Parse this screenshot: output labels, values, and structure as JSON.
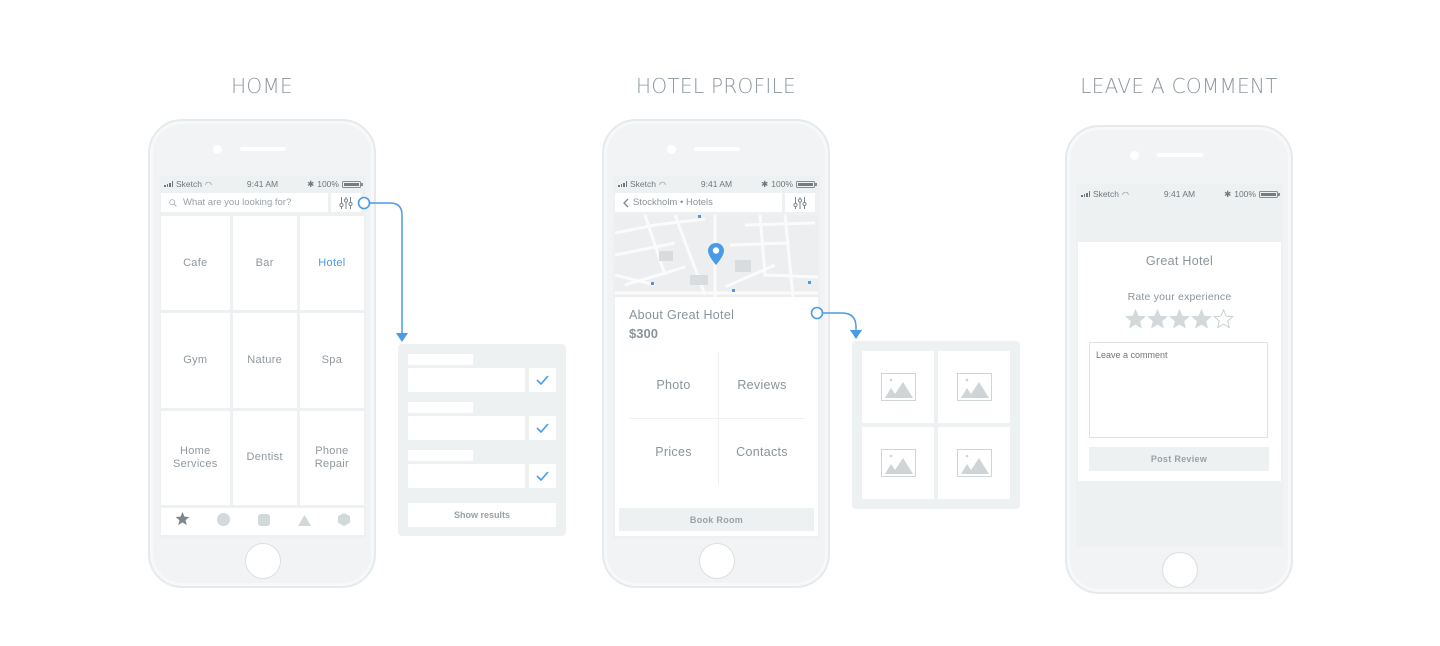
{
  "titles": {
    "home": "HOME",
    "hotel_profile": "HOTEL PROFILE",
    "leave_comment": "LEAVE A COMMENT"
  },
  "statusbar": {
    "carrier": "Sketch",
    "time": "9:41 AM",
    "battery": "100%"
  },
  "home": {
    "search_placeholder": "What are you looking for?",
    "categories": [
      {
        "label": "Cafe",
        "active": false
      },
      {
        "label": "Bar",
        "active": false
      },
      {
        "label": "Hotel",
        "active": true
      },
      {
        "label": "Gym",
        "active": false
      },
      {
        "label": "Nature",
        "active": false
      },
      {
        "label": "Spa",
        "active": false
      },
      {
        "label": "Home Services",
        "active": false
      },
      {
        "label": "Dentist",
        "active": false
      },
      {
        "label": "Phone Repair",
        "active": false
      }
    ],
    "tabbar": [
      "star-icon",
      "circle-icon",
      "square-icon",
      "triangle-icon",
      "hexagon-icon"
    ]
  },
  "filter_panel": {
    "rows_checked": [
      true,
      true,
      true
    ],
    "show_results_label": "Show results"
  },
  "hotel": {
    "breadcrumb": "Stockholm • Hotels",
    "about_title": "About Great Hotel",
    "price": "$300",
    "sections": [
      "Photo",
      "Reviews",
      "Prices",
      "Contacts"
    ],
    "book_label": "Book Room"
  },
  "photo_panel": {
    "photo_count": 4
  },
  "comment": {
    "hotel_name": "Great Hotel",
    "rate_label": "Rate your experience",
    "rating": 4,
    "rating_max": 5,
    "comment_placeholder": "Leave a comment",
    "post_label": "Post Review"
  },
  "colors": {
    "accent": "#4a9ae6",
    "text": "#8a949c",
    "panel": "#eef1f2"
  }
}
